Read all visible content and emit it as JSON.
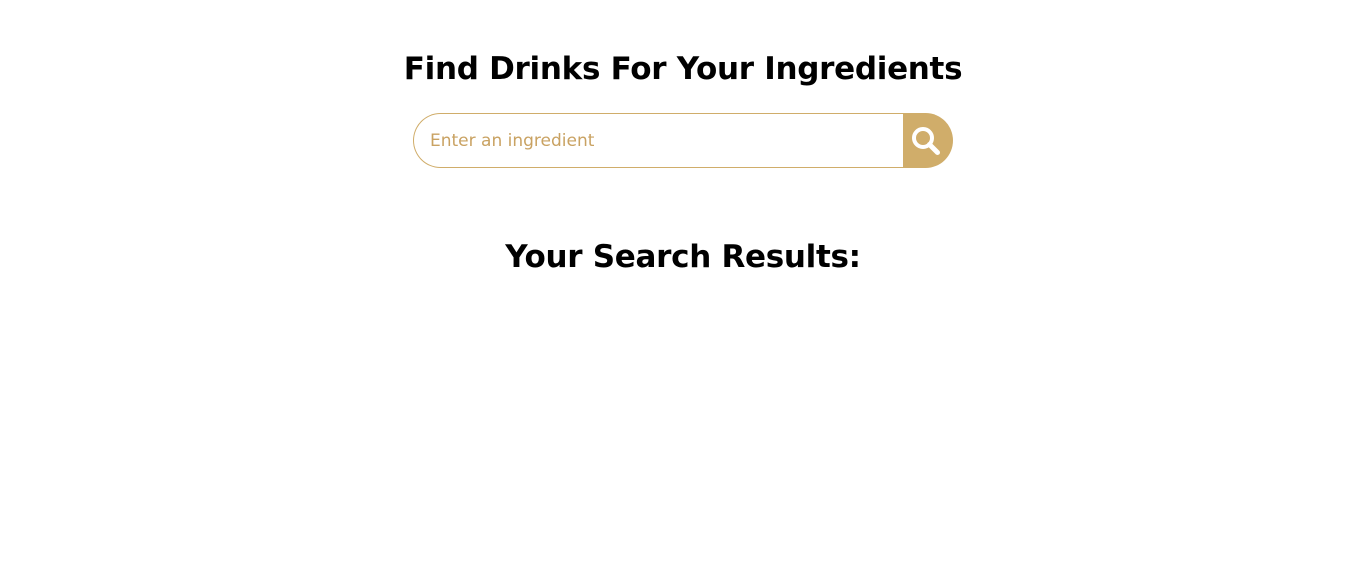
{
  "header": {
    "title": "Find Drinks For Your Ingredients"
  },
  "search": {
    "placeholder": "Enter an ingredient",
    "value": "",
    "button_icon": "search-icon"
  },
  "results": {
    "title": "Your Search Results:",
    "items": []
  },
  "colors": {
    "accent": "#d0ad6a",
    "text": "#000000",
    "background": "#ffffff"
  }
}
